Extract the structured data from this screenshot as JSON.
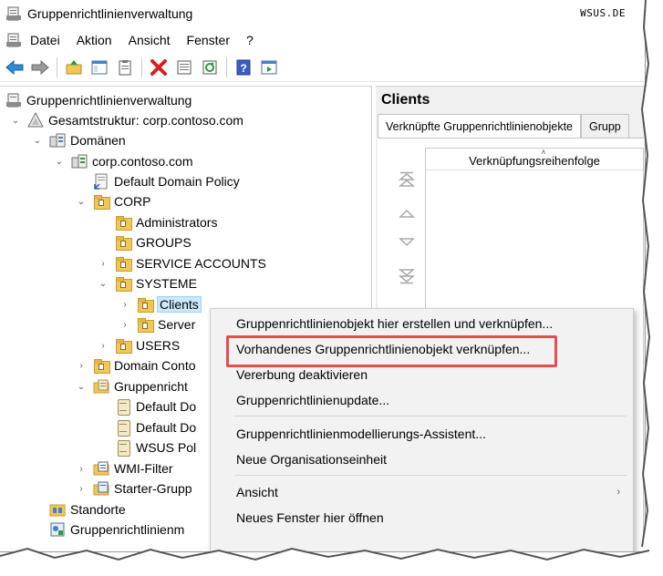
{
  "window": {
    "title": "Gruppenrichtlinienverwaltung",
    "watermark": "WSUS.DE"
  },
  "menubar": {
    "items": [
      "Datei",
      "Aktion",
      "Ansicht",
      "Fenster",
      "?"
    ]
  },
  "toolbar": {
    "buttons": [
      "back-arrow-icon",
      "forward-arrow-icon",
      "up-folder-icon",
      "show-hide-tree-icon",
      "clipboard-icon",
      "delete-icon",
      "properties-icon",
      "refresh-icon",
      "help-icon",
      "action-pane-icon"
    ]
  },
  "tree": {
    "nodes": [
      {
        "label": "Gruppenrichtlinienverwaltung",
        "icon": "gpm-icon",
        "twisty": ""
      },
      {
        "label": "Gesamtstruktur: corp.contoso.com",
        "icon": "forest-icon",
        "twisty": "expanded"
      },
      {
        "label": "Domänen",
        "icon": "domains-icon",
        "twisty": "expanded"
      },
      {
        "label": "corp.contoso.com",
        "icon": "domain-icon",
        "twisty": "expanded"
      },
      {
        "label": "Default Domain Policy",
        "icon": "gpo-link-icon",
        "twisty": ""
      },
      {
        "label": "CORP",
        "icon": "ou-folder-icon",
        "twisty": "expanded"
      },
      {
        "label": "Administrators",
        "icon": "ou-folder-icon",
        "twisty": ""
      },
      {
        "label": "GROUPS",
        "icon": "ou-folder-icon",
        "twisty": ""
      },
      {
        "label": "SERVICE ACCOUNTS",
        "icon": "ou-folder-icon",
        "twisty": "collapsed"
      },
      {
        "label": "SYSTEME",
        "icon": "ou-folder-icon",
        "twisty": "expanded"
      },
      {
        "label": "Clients",
        "icon": "ou-folder-icon",
        "twisty": "collapsed"
      },
      {
        "label": "Server",
        "icon": "ou-folder-icon",
        "twisty": "collapsed"
      },
      {
        "label": "USERS",
        "icon": "ou-folder-icon",
        "twisty": "collapsed"
      },
      {
        "label": "Domain Conto",
        "icon": "ou-folder-icon",
        "twisty": "collapsed"
      },
      {
        "label": "Gruppenricht",
        "icon": "gpo-folder-icon",
        "twisty": "expanded"
      },
      {
        "label": "Default Do",
        "icon": "gpo-scroll-icon",
        "twisty": ""
      },
      {
        "label": "Default Do",
        "icon": "gpo-scroll-icon",
        "twisty": ""
      },
      {
        "label": "WSUS Pol",
        "icon": "gpo-scroll-icon",
        "twisty": ""
      },
      {
        "label": "WMI-Filter",
        "icon": "wmi-folder-icon",
        "twisty": "collapsed"
      },
      {
        "label": "Starter-Grupp",
        "icon": "starter-folder-icon",
        "twisty": "collapsed"
      },
      {
        "label": "Standorte",
        "icon": "sites-icon",
        "twisty": ""
      },
      {
        "label": "Gruppenrichtlinienm",
        "icon": "modeling-icon",
        "twisty": ""
      }
    ]
  },
  "right_pane": {
    "title": "Clients",
    "tabs": [
      "Verknüpfte Gruppenrichtlinienobjekte",
      "Grupp"
    ],
    "list_header": "Verknüpfungsreihenfolge"
  },
  "context_menu": {
    "items": [
      {
        "label": "Gruppenrichtlinienobjekt hier erstellen und verknüpfen..."
      },
      {
        "label": "Vorhandenes Gruppenrichtlinienobjekt verknüpfen..."
      },
      {
        "label": "Vererbung deaktivieren"
      },
      {
        "label": "Gruppenrichtlinienupdate..."
      },
      {
        "label": "Gruppenrichtlinienmodellierungs-Assistent..."
      },
      {
        "label": "Neue Organisationseinheit"
      },
      {
        "label": "Ansicht",
        "submenu": true
      },
      {
        "label": "Neues Fenster hier öffnen"
      }
    ],
    "highlighted_index": 1,
    "highlight_color": "#e1504f"
  }
}
